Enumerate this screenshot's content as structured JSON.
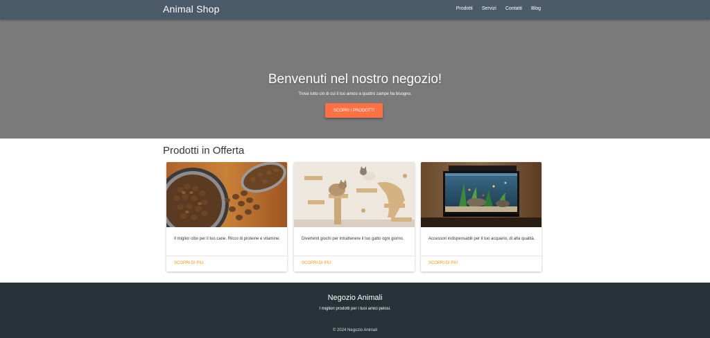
{
  "navbar": {
    "brand": "Animal Shop",
    "links": [
      "Prodotti",
      "Servizi",
      "Contatti",
      "Blog"
    ]
  },
  "hero": {
    "title": "Benvenuti nel nostro negozio!",
    "subtitle": "Trova tutto ciò di cui il tuo amico a quattro zampe ha bisogno.",
    "button_label": "SCOPRI I PRODOTTI"
  },
  "offers": {
    "title": "Prodotti in Offerta",
    "cards": [
      {
        "image": "dog-food-photo",
        "text": "Il miglior cibo per il tuo cane. Ricco di proteine e vitamine.",
        "link": "SCOPRI DI PIÙ"
      },
      {
        "image": "cat-climbing-photo",
        "text": "Divertenti giochi per intrattenere il tuo gatto ogni giorno.",
        "link": "SCOPRI DI PIÙ"
      },
      {
        "image": "aquarium-photo",
        "text": "Accessori indispensabili per il tuo acquario, di alta qualità.",
        "link": "SCOPRI DI PIÙ"
      }
    ]
  },
  "footer": {
    "title": "Negozio Animali",
    "subtitle": "I migliori prodotti per i tuoi amici pelosi.",
    "copyright": "© 2024 Negozio Animali"
  },
  "colors": {
    "navbar": "#4a5a68",
    "hero": "#7a7a7a",
    "accent_button": "#ff7043",
    "link": "#ff9800",
    "footer": "#263238"
  }
}
